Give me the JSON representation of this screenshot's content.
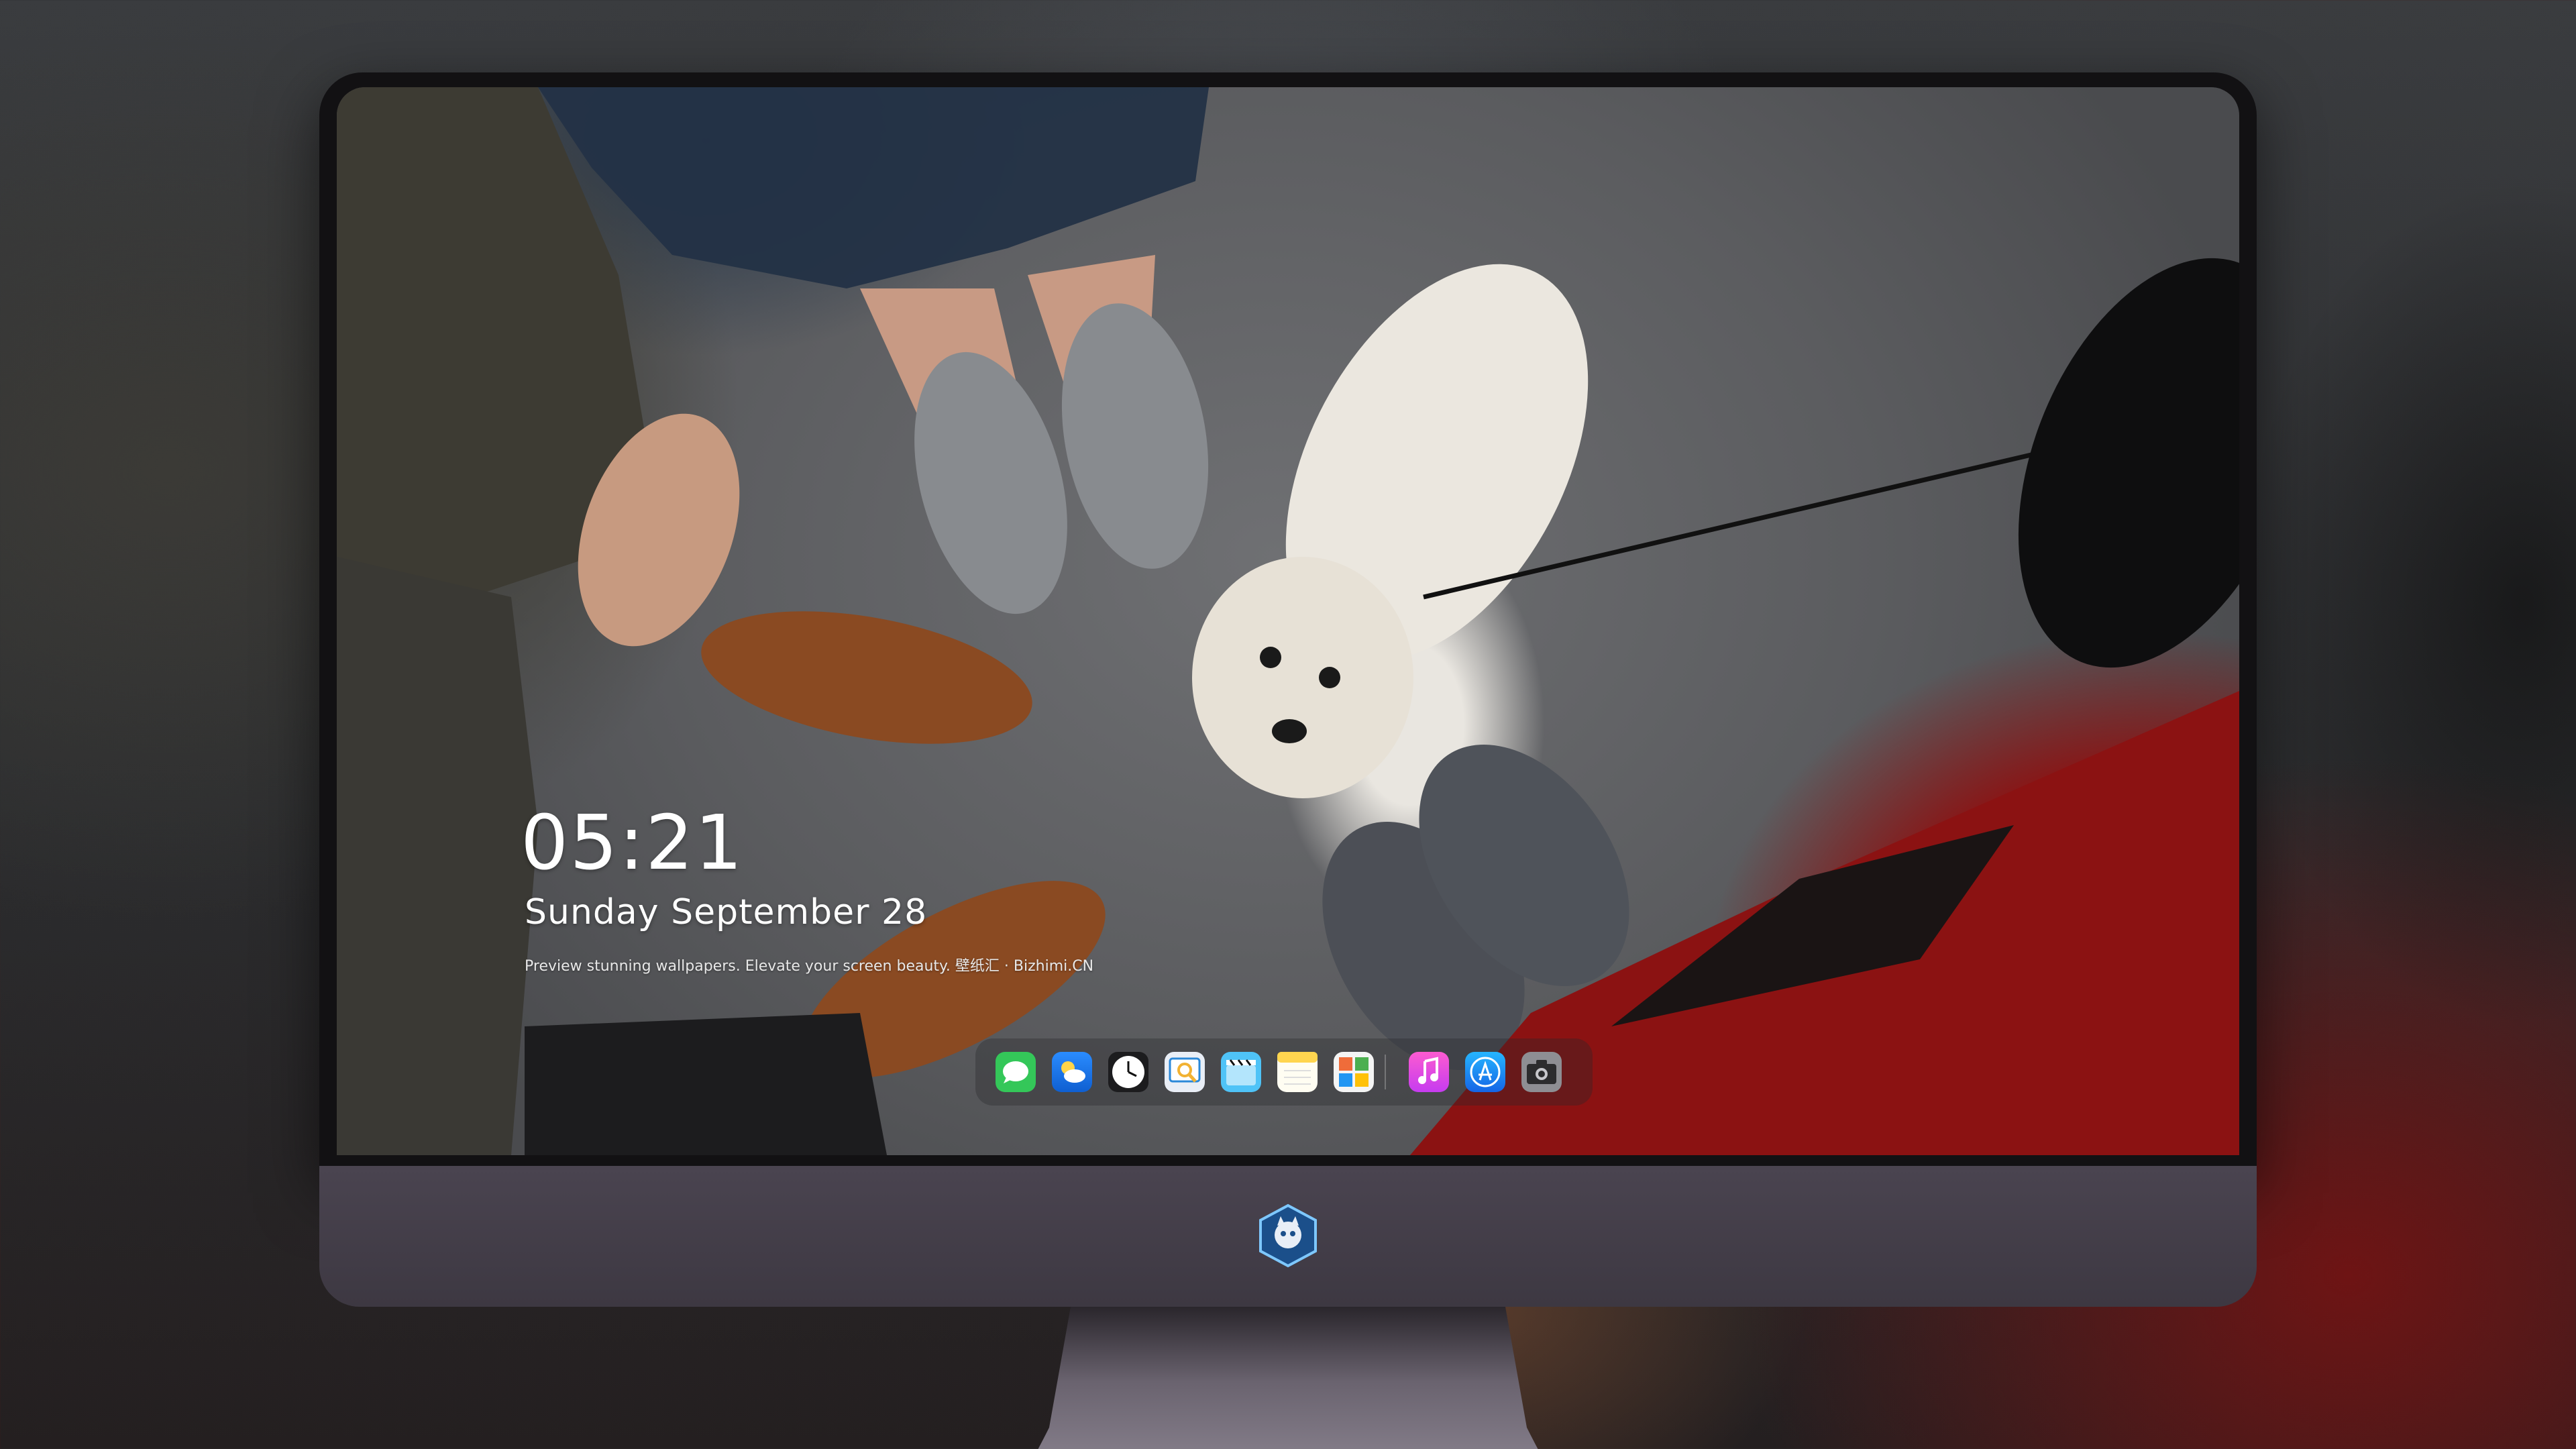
{
  "lock_screen": {
    "time": "05:21",
    "date": "Sunday September  28",
    "tagline": "Preview stunning wallpapers. Elevate your screen beauty. 壁纸汇 · Bizhimi.CN"
  },
  "dock": {
    "apps": [
      {
        "icon": "messages-icon",
        "color": "#34c759"
      },
      {
        "icon": "weather-icon",
        "color": "#1e88ff"
      },
      {
        "icon": "clock-icon",
        "color": "#1c1c1e"
      },
      {
        "icon": "preview-icon",
        "color": "#f2c94c"
      },
      {
        "icon": "clips-icon",
        "color": "#4fc3f7"
      },
      {
        "icon": "notes-icon",
        "color": "#ffd54f"
      },
      {
        "icon": "photo-booth-icon",
        "color": "#ef6c3a"
      },
      {
        "icon": "music-icon",
        "color": "#fb5bc5"
      },
      {
        "icon": "app-store-icon",
        "color": "#2196f3"
      },
      {
        "icon": "camera-icon",
        "color": "#8e8e93"
      }
    ]
  },
  "colors": {
    "chin": "#433d48",
    "bezel": "#121113"
  }
}
